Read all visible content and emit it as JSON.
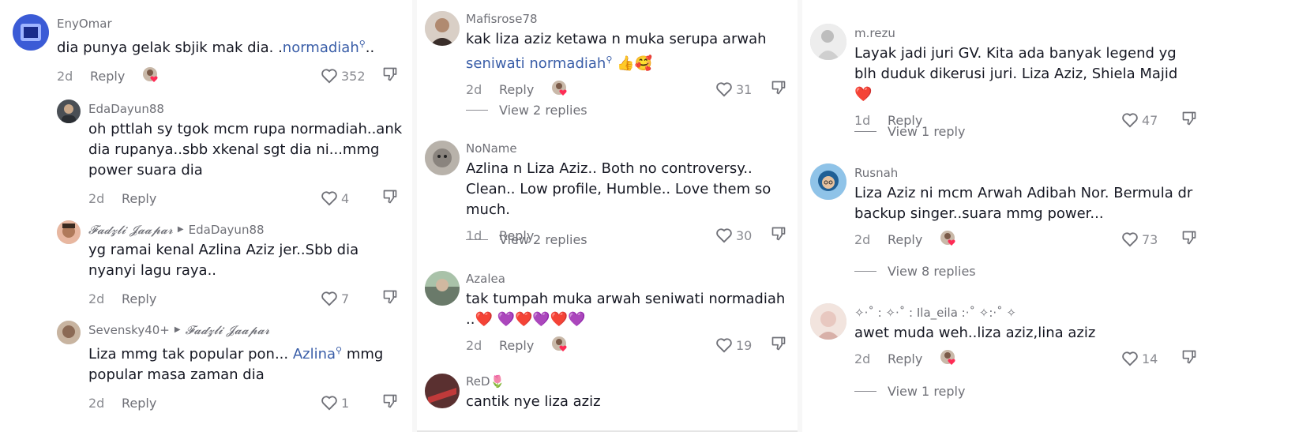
{
  "columns": [
    {
      "comments": [
        {
          "user": "EnyOmar",
          "text": "dia punya gelak sbjik mak dia. .",
          "mention": "normadiah",
          "after": "..",
          "time": "2d",
          "reply": "Reply",
          "likes": "352",
          "avatar_color": "#3b5bd6"
        },
        {
          "user": "EdaDayun88",
          "text": "oh pttlah sy tgok mcm rupa normadiah..ank dia rupanya..sbb xkenal sgt dia ni...mmg power suara dia",
          "time": "2d",
          "reply": "Reply",
          "likes": "4",
          "avatar_color": "#4a4f55"
        },
        {
          "user": "𝓕𝓪𝓭𝔃𝓵𝓲 𝓙𝓪𝓪𝓹𝓪𝓻",
          "reply_to": "EdaDayun88",
          "text": "yg ramai kenal Azlina Aziz jer..Sbb dia nyanyi lagu raya..",
          "time": "2d",
          "reply": "Reply",
          "likes": "7",
          "avatar_color": "#b07a5a"
        },
        {
          "user": "Sevensky40+",
          "reply_to": "𝓕𝓪𝓭𝔃𝓵𝓲 𝓙𝓪𝓪𝓹𝓪𝓻",
          "text": "Liza mmg tak popular pon... ",
          "mention": "Azlina",
          "after": " mmg popular masa zaman dia",
          "time": "2d",
          "reply": "Reply",
          "likes": "1",
          "avatar_color": "#8b6a55"
        }
      ]
    },
    {
      "comments": [
        {
          "user": "Mafisrose78",
          "text": "kak liza aziz ketawa n muka serupa arwah ",
          "mention": "seniwati normadiah",
          "after": " 👍🥰",
          "time": "2d",
          "reply": "Reply",
          "likes": "31",
          "view_replies": "View 2 replies",
          "avatar_color": "#6b5a50"
        },
        {
          "user": "NoName",
          "text": "Azlina n Liza Aziz.. Both no controversy.. Clean.. Low profile, Humble.. Love them so much.",
          "time": "1d",
          "reply": "Reply",
          "likes": "30",
          "view_replies": "View 2 replies",
          "avatar_color": "#9a9590"
        },
        {
          "user": "Azalea",
          "text": "tak tumpah muka arwah seniwati normadiah ..❤️ 💜❤️💜❤️💜",
          "time": "2d",
          "reply": "Reply",
          "likes": "19",
          "avatar_color": "#7a8a7a"
        },
        {
          "user": "ReD🌷",
          "text": "cantik nye liza aziz",
          "avatar_color": "#8a2a2a"
        }
      ]
    },
    {
      "comments": [
        {
          "user": "m.rezu",
          "text": "Layak jadi juri GV. Kita ada banyak legend yg blh duduk dikerusi juri. Liza Aziz, Shiela Majid ❤️",
          "time": "1d",
          "reply": "Reply",
          "likes": "47",
          "view_replies": "View 1 reply",
          "avatar_color": "#d8d8d8"
        },
        {
          "user": "Rusnah",
          "text": "Liza Aziz ni mcm Arwah Adibah Nor. Bermula dr backup singer..suara mmg power...",
          "time": "2d",
          "reply": "Reply",
          "likes": "73",
          "view_replies": "View 8 replies",
          "avatar_color": "#3a7ab0"
        },
        {
          "user": "✧·˚ : ✧·˚ : Ila_eila :·˚ ✧:·˚ ✧",
          "text": "awet muda weh..liza aziz,lina aziz",
          "time": "2d",
          "reply": "Reply",
          "likes": "14",
          "view_replies": "View 1 reply",
          "avatar_color": "#e8c8c0"
        }
      ]
    }
  ],
  "icons": {
    "heart": "heart-outline-icon",
    "dislike": "thumbs-down-icon",
    "badge": "creator-liked-badge-icon",
    "search": "search-mention-icon"
  }
}
